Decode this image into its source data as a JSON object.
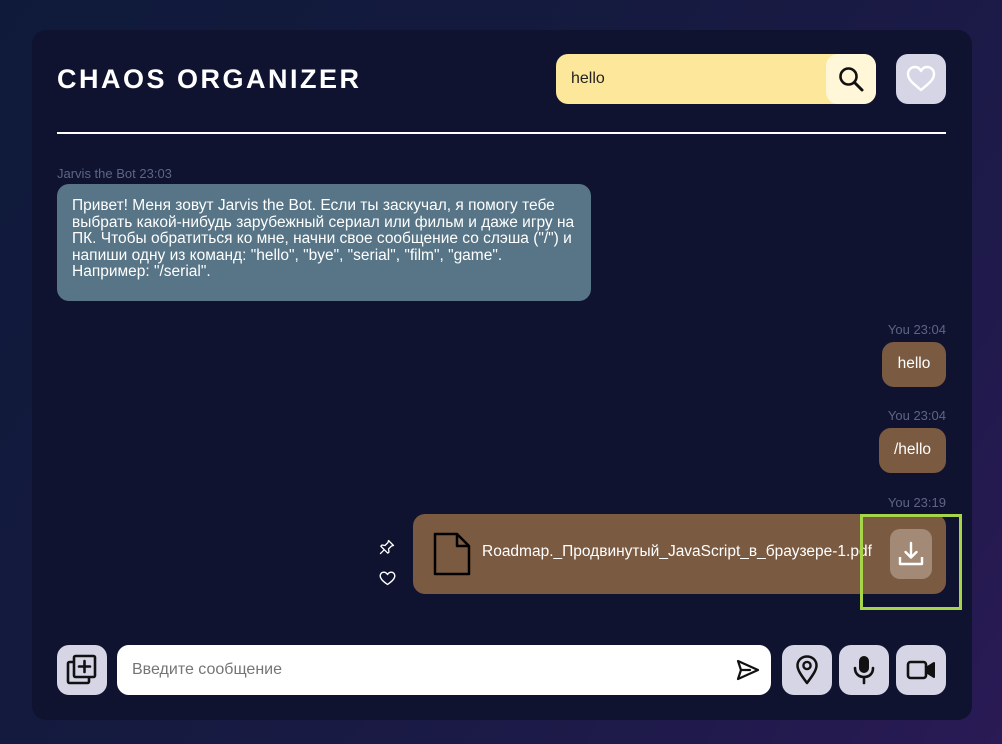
{
  "header": {
    "title": "CHAOS ORGANIZER",
    "search_value": "hello",
    "search_icon": "search-icon",
    "favorites_icon": "heart-icon"
  },
  "messages": [
    {
      "author": "Jarvis the Bot",
      "time": "23:03",
      "meta": "Jarvis the Bot 23:03",
      "text": "Привет! Меня зовут Jarvis the Bot. Если ты заскучал, я помогу тебе выбрать какой-нибудь зарубежный сериал или фильм и даже игру на ПК. Чтобы обратиться ко мне, начни свое сообщение со слэша (\"/\") и напиши одну из команд: \"hello\", \"bye\", \"serial\", \"film\", \"game\". Например: \"/serial\"."
    },
    {
      "author": "You",
      "time": "23:04",
      "meta": "You 23:04",
      "text": "hello"
    },
    {
      "author": "You",
      "time": "23:04",
      "meta": "You 23:04",
      "text": "/hello"
    },
    {
      "author": "You",
      "time": "23:19",
      "meta": "You 23:19",
      "file_name": "Roadmap._Продвинутый_JavaScript_в_браузере-1.pdf",
      "file_icon": "file-icon",
      "download_icon": "download-icon",
      "actions": [
        "pin-icon",
        "heart-icon"
      ]
    }
  ],
  "composer": {
    "placeholder": "Введите сообщение",
    "attach_icon": "add-file-icon",
    "send_icon": "send-icon",
    "location_icon": "location-pin-icon",
    "mic_icon": "microphone-icon",
    "video_icon": "video-camera-icon"
  },
  "colors": {
    "background": "#151a3f",
    "panel": "#0f1330",
    "search_bg": "#fde79a",
    "bot_bubble": "#577586",
    "user_bubble": "#7a5a41",
    "button_bg": "#d6d5e6",
    "highlight": "#a6d54a"
  }
}
